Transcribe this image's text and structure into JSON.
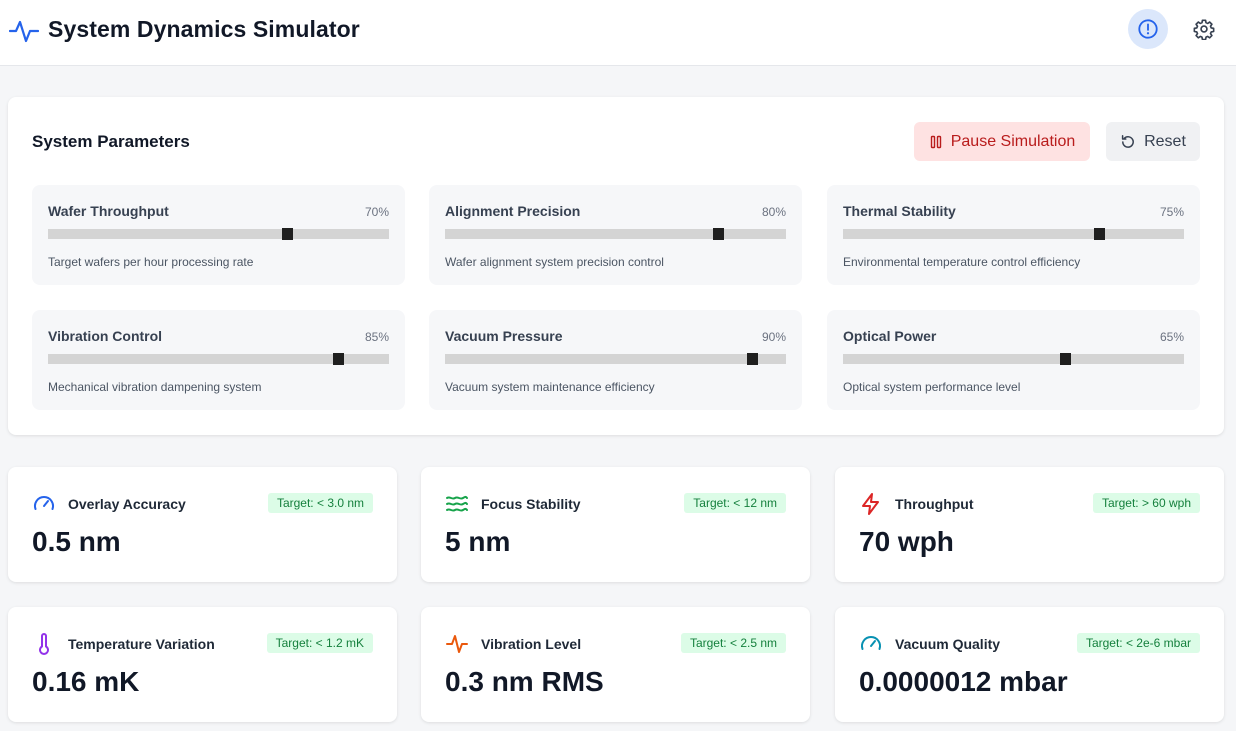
{
  "header": {
    "title": "System Dynamics Simulator",
    "logo_icon": "activity-pulse-icon",
    "alert_icon": "alert-circle-icon",
    "settings_icon": "gear-icon",
    "accent_color": "#2563eb"
  },
  "parameters": {
    "title": "System Parameters",
    "pause_label": "Pause Simulation",
    "reset_label": "Reset",
    "items": [
      {
        "name": "Wafer Throughput",
        "value": 70,
        "value_label": "70%",
        "description": "Target wafers per hour processing rate"
      },
      {
        "name": "Alignment Precision",
        "value": 80,
        "value_label": "80%",
        "description": "Wafer alignment system precision control"
      },
      {
        "name": "Thermal Stability",
        "value": 75,
        "value_label": "75%",
        "description": "Environmental temperature control efficiency"
      },
      {
        "name": "Vibration Control",
        "value": 85,
        "value_label": "85%",
        "description": "Mechanical vibration dampening system"
      },
      {
        "name": "Vacuum Pressure",
        "value": 90,
        "value_label": "90%",
        "description": "Vacuum system maintenance efficiency"
      },
      {
        "name": "Optical Power",
        "value": 65,
        "value_label": "65%",
        "description": "Optical system performance level"
      }
    ]
  },
  "metrics": [
    {
      "name": "Overlay Accuracy",
      "target": "Target: < 3.0 nm",
      "value": "0.5 nm",
      "icon": "gauge-icon",
      "icon_color": "#2563eb"
    },
    {
      "name": "Focus Stability",
      "target": "Target: < 12 nm",
      "value": "5 nm",
      "icon": "waves-icon",
      "icon_color": "#16a34a"
    },
    {
      "name": "Throughput",
      "target": "Target: > 60 wph",
      "value": "70 wph",
      "icon": "lightning-icon",
      "icon_color": "#dc2626"
    },
    {
      "name": "Temperature Variation",
      "target": "Target: < 1.2 mK",
      "value": "0.16 mK",
      "icon": "thermometer-icon",
      "icon_color": "#9333ea"
    },
    {
      "name": "Vibration Level",
      "target": "Target: < 2.5 nm",
      "value": "0.3 nm RMS",
      "icon": "activity-icon",
      "icon_color": "#ea580c"
    },
    {
      "name": "Vacuum Quality",
      "target": "Target: < 2e-6 mbar",
      "value": "0.0000012 mbar",
      "icon": "gauge-icon",
      "icon_color": "#0891b2"
    }
  ]
}
